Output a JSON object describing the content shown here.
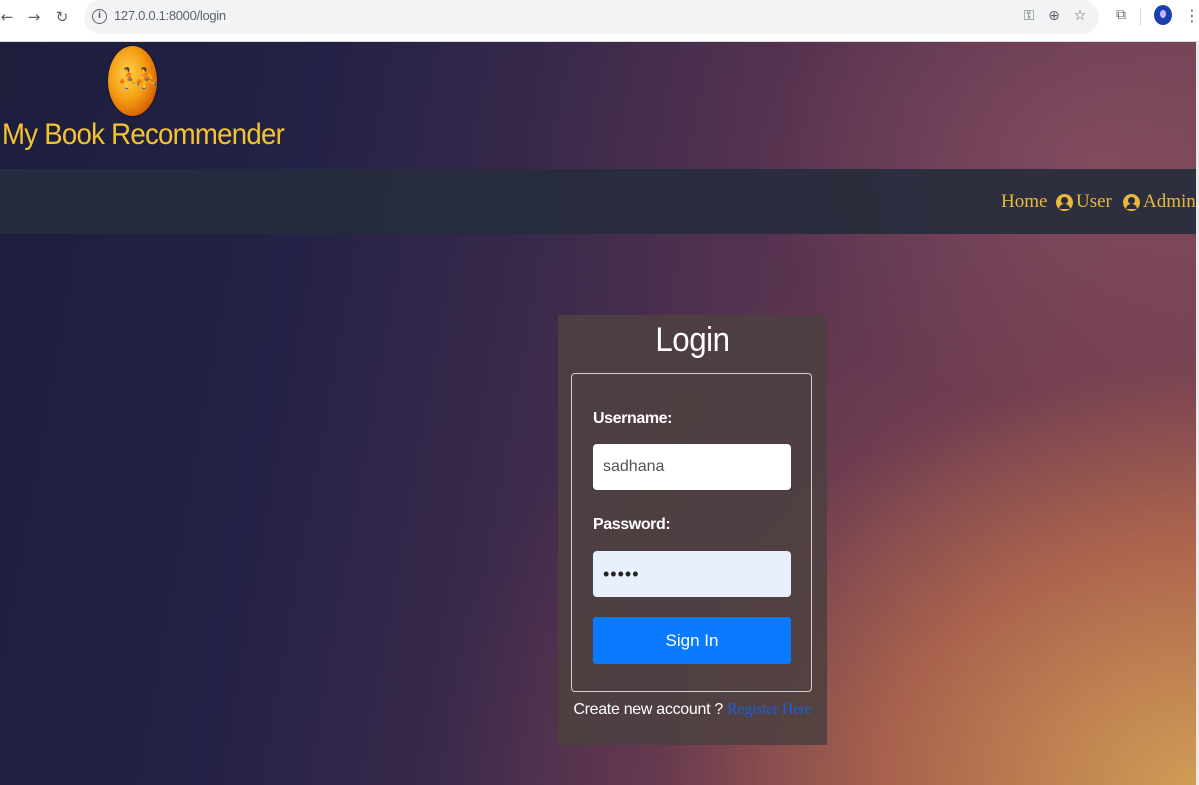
{
  "browser": {
    "url": "127.0.0.1:8000/login"
  },
  "header": {
    "site_title": "My Book Recommender"
  },
  "nav": {
    "home": "Home",
    "user": "User",
    "admin": "Admin"
  },
  "login": {
    "title": "Login",
    "username_label": "Username:",
    "username_value": "sadhana",
    "password_label": "Password:",
    "password_value": "•••••",
    "submit_label": "Sign In",
    "register_prompt": "Create new account ?",
    "register_link": "Register Here"
  },
  "colors": {
    "title_gold": "#f4c430",
    "nav_gold": "#e8b93a",
    "button_blue": "#0a7bff",
    "link_blue": "#1d5fd6"
  },
  "icons": [
    "back-arrow-icon",
    "forward-arrow-icon",
    "reload-icon",
    "site-info-icon",
    "key-icon",
    "zoom-icon",
    "star-icon",
    "extensions-icon",
    "profile-avatar",
    "menu-kebab-icon",
    "user-circle-icon"
  ]
}
